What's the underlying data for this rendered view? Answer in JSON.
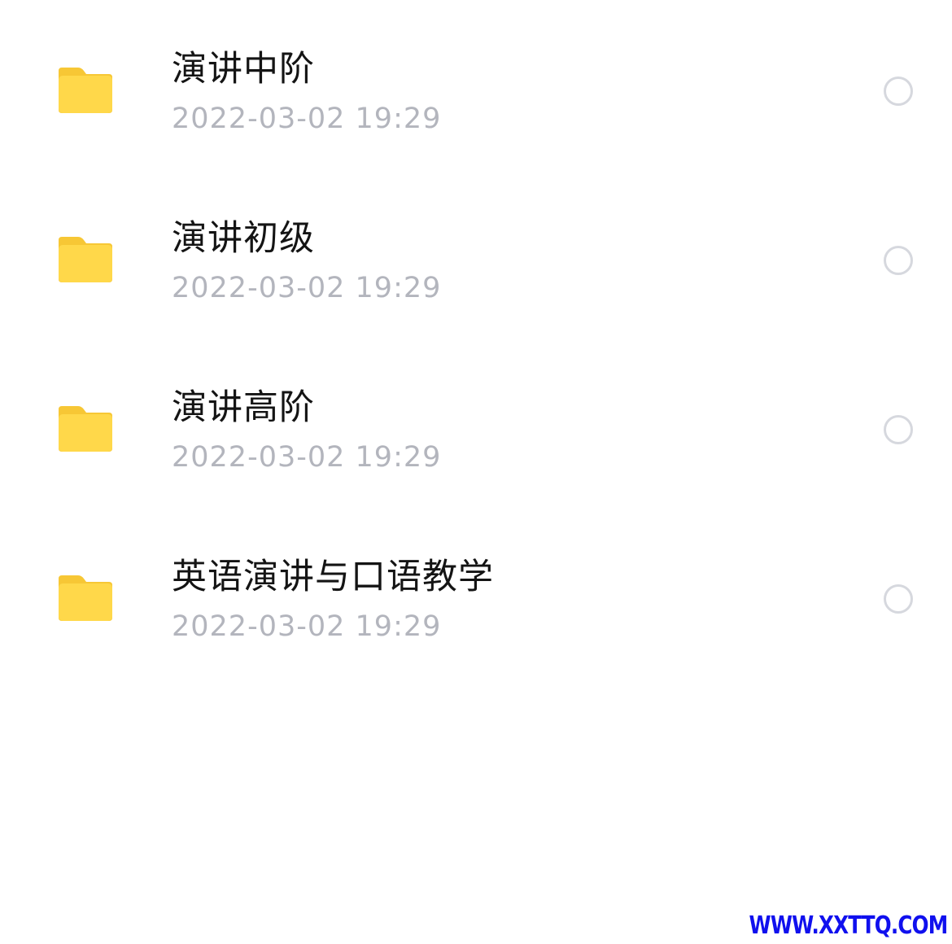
{
  "files": [
    {
      "name": "演讲中阶",
      "date": "2022-03-02 19:29",
      "icon": "folder-icon",
      "selected": false
    },
    {
      "name": "演讲初级",
      "date": "2022-03-02 19:29",
      "icon": "folder-icon",
      "selected": false
    },
    {
      "name": "演讲高阶",
      "date": "2022-03-02 19:29",
      "icon": "folder-icon",
      "selected": false
    },
    {
      "name": "英语演讲与口语教学",
      "date": "2022-03-02 19:29",
      "icon": "folder-icon",
      "selected": false
    }
  ],
  "watermark": "WWW.XXTTQ.COM",
  "colors": {
    "folder_body": "#FFD84A",
    "folder_tab": "#F7C735",
    "name_text": "#141414",
    "date_text": "#B3B5BD",
    "radio_border": "#D6D8DE",
    "watermark": "#1010EE"
  }
}
